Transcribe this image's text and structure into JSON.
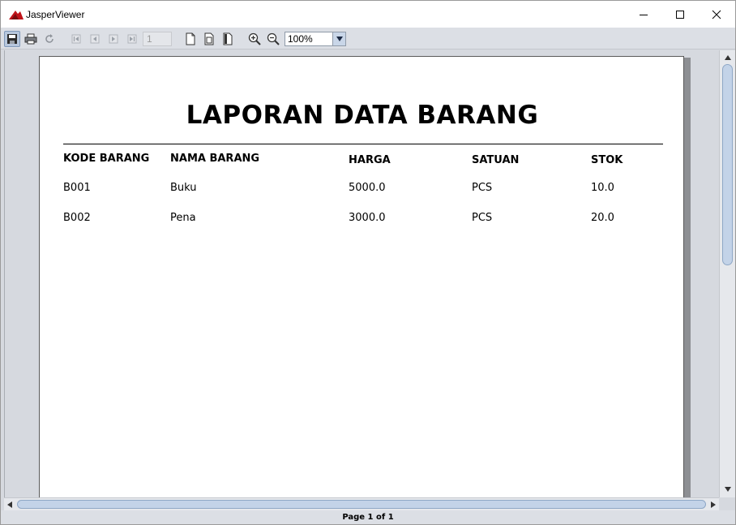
{
  "window": {
    "title": "JasperViewer"
  },
  "toolbar": {
    "page_number": "1",
    "zoom": "100%"
  },
  "report": {
    "title": "LAPORAN DATA BARANG",
    "columns": [
      "KODE BARANG",
      "NAMA BARANG",
      "HARGA",
      "SATUAN",
      "STOK"
    ],
    "rows": [
      [
        "B001",
        "Buku",
        "5000.0",
        "PCS",
        "10.0"
      ],
      [
        "B002",
        "Pena",
        "3000.0",
        "PCS",
        "20.0"
      ]
    ]
  },
  "status": {
    "page_info": "Page 1 of 1"
  },
  "icons": {
    "save": "save-icon",
    "print": "print-icon",
    "reload": "reload-icon",
    "first": "first-page-icon",
    "previous": "previous-page-icon",
    "next": "next-page-icon",
    "last": "last-page-icon",
    "actual_size": "actual-size-icon",
    "fit_page": "fit-page-icon",
    "fit_width": "fit-width-icon",
    "zoom_in": "zoom-in-icon",
    "zoom_out": "zoom-out-icon"
  },
  "colors": {
    "title_logo": "#c0141a",
    "scroll_thumb": "#c3d3e8"
  }
}
